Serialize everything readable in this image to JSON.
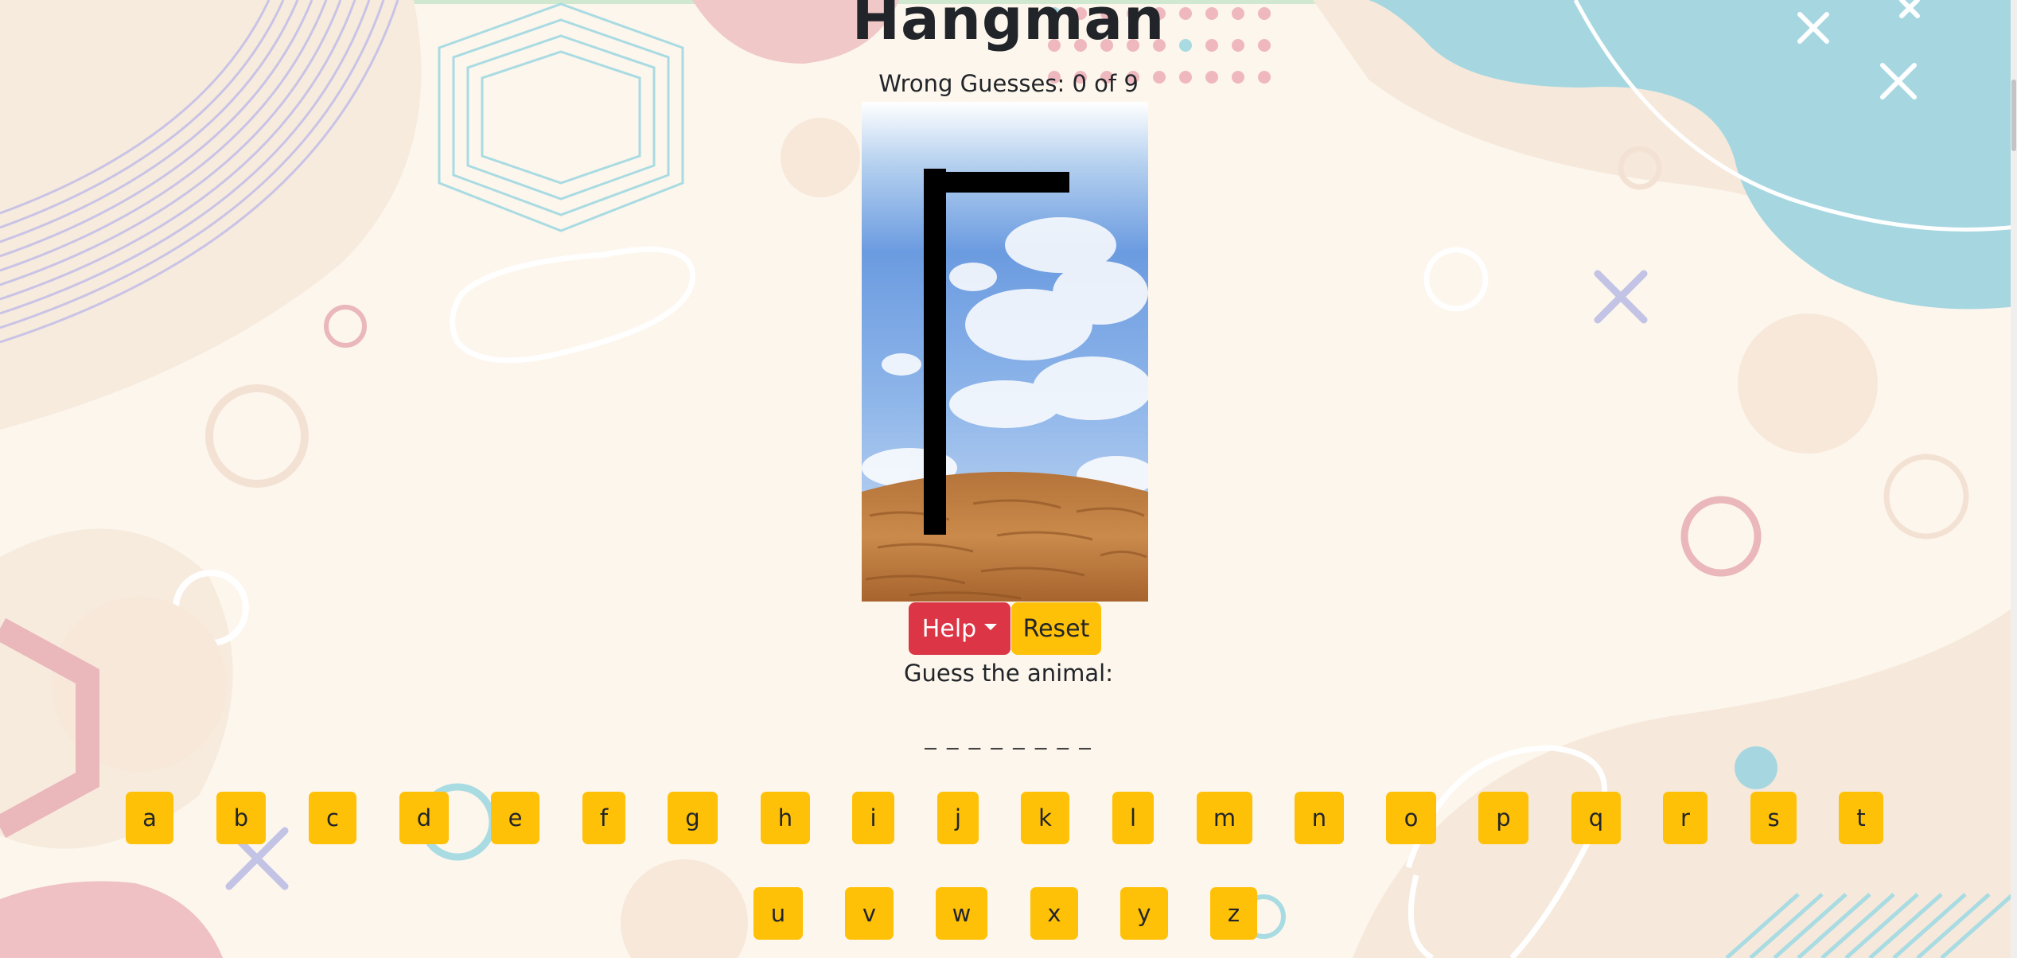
{
  "game": {
    "title": "Hangman",
    "wrong_guesses": "Wrong Guesses: 0 of 9",
    "prompt": "Guess the animal:",
    "word_display": "_ _ _ _ _ _ _ _"
  },
  "buttons": {
    "help": "Help",
    "reset": "Reset"
  },
  "keyboard": {
    "row1": [
      "a",
      "b",
      "c",
      "d",
      "e",
      "f",
      "g",
      "h",
      "i",
      "j",
      "k",
      "l",
      "m",
      "n",
      "o",
      "p",
      "q",
      "r",
      "s",
      "t"
    ],
    "row2": [
      "u",
      "v",
      "w",
      "x",
      "y",
      "z"
    ]
  },
  "colors": {
    "background": "#fdf6ec",
    "help_button": "#dc3545",
    "key_button": "#ffc107"
  }
}
